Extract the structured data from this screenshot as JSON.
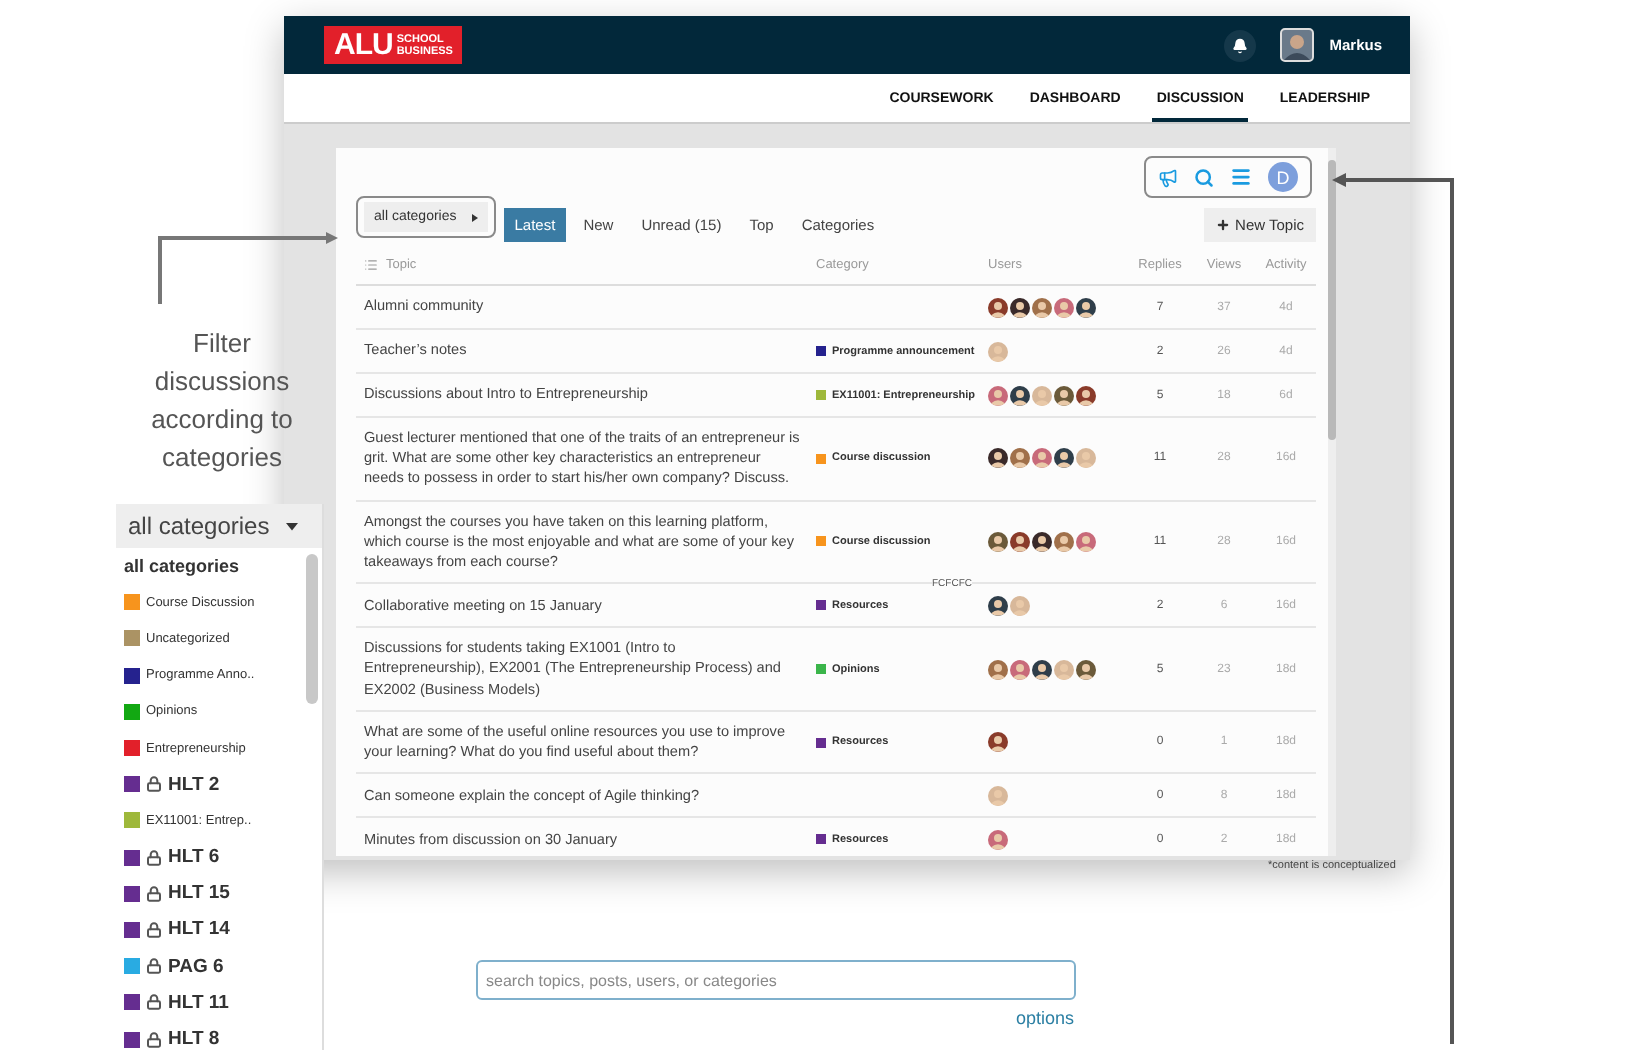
{
  "header": {
    "logo": {
      "mark": "ALU",
      "line_1": "SCHOOL",
      "line_2": "BUSINESS"
    },
    "user_name": "Markus"
  },
  "nav": [
    {
      "label": "COURSEWORK",
      "selected": false
    },
    {
      "label": "DASHBOARD",
      "selected": false
    },
    {
      "label": "DISCUSSION",
      "selected": true
    },
    {
      "label": "LEADERSHIP",
      "selected": false
    }
  ],
  "filter": {
    "label": "all categories"
  },
  "tabs": [
    {
      "label": "Latest",
      "selected": true
    },
    {
      "label": "New",
      "selected": false
    },
    {
      "label": "Unread (15)",
      "selected": false
    },
    {
      "label": "Top",
      "selected": false
    },
    {
      "label": "Categories",
      "selected": false
    }
  ],
  "new_topic_button": {
    "label": "New Topic"
  },
  "user_badge": {
    "letter": "D"
  },
  "table": {
    "columns": [
      "Topic",
      "Category",
      "Users",
      "Replies",
      "Views",
      "Activity"
    ],
    "rows": [
      {
        "topic": "Alumni community",
        "users": [
          {
            "kind": "avatar"
          },
          {
            "kind": "avatar"
          },
          {
            "kind": "avatar"
          },
          {
            "kind": "avatar"
          },
          {
            "kind": "avatar"
          }
        ],
        "replies": "7",
        "views": "37",
        "activity": "4d"
      },
      {
        "topic": "Teacher’s notes",
        "category": {
          "label": "Programme announcement",
          "color": "#25228e"
        },
        "users": [
          {
            "kind": "avatar"
          }
        ],
        "replies": "2",
        "views": "26",
        "activity": "4d"
      },
      {
        "topic": "Discussions about Intro to Entrepreneurship",
        "category": {
          "label": "EX11001: Entrepreneurship",
          "color": "#9eb83b"
        },
        "users": [
          {
            "kind": "avatar"
          },
          {
            "kind": "avatar"
          },
          {
            "kind": "avatar"
          },
          {
            "kind": "avatar"
          },
          {
            "kind": "avatar"
          }
        ],
        "replies": "5",
        "views": "18",
        "activity": "6d"
      },
      {
        "topic": "Guest lecturer mentioned that one of the traits of an entrepreneur is grit. What are some other key characteristics an entrepreneur needs to possess in order to start his/her own company? Discuss.",
        "category": {
          "label": "Course discussion",
          "color": "#f7941d"
        },
        "users": [
          {
            "kind": "avatar"
          },
          {
            "kind": "avatar"
          },
          {
            "kind": "avatar"
          },
          {
            "kind": "avatar"
          },
          {
            "kind": "avatar"
          }
        ],
        "replies": "11",
        "views": "28",
        "activity": "16d"
      },
      {
        "topic": "Amongst the courses you have taken on this learning platform, which course is the most enjoyable and what are some of your key takeaways from each course?",
        "category": {
          "label": "Course discussion",
          "color": "#f7941d"
        },
        "users": [
          {
            "kind": "avatar"
          },
          {
            "kind": "avatar"
          },
          {
            "kind": "avatar"
          },
          {
            "kind": "avatar"
          },
          {
            "kind": "avatar"
          }
        ],
        "replies": "11",
        "views": "28",
        "activity": "16d",
        "note": "FCFCFC"
      },
      {
        "topic": "Collaborative meeting on 15 January",
        "category": {
          "label": "Resources",
          "color": "#652d90"
        },
        "users": [
          {
            "kind": "avatar"
          },
          {
            "kind": "avatar"
          }
        ],
        "replies": "2",
        "views": "6",
        "activity": "16d"
      },
      {
        "topic": "Discussions for students taking EX1001 (Intro to Entrepreneurship), EX2001 (The Entrepreneurship Process) and EX2002 (Business Models)",
        "category": {
          "label": "Opinions",
          "color": "#3ab54a"
        },
        "users": [
          {
            "kind": "avatar"
          },
          {
            "kind": "avatar"
          },
          {
            "kind": "avatar"
          },
          {
            "kind": "avatar"
          },
          {
            "kind": "avatar"
          }
        ],
        "replies": "5",
        "views": "23",
        "activity": "18d"
      },
      {
        "topic": "What are some of the useful online resources you use to improve your learning? What do you find useful about them?",
        "category": {
          "label": "Resources",
          "color": "#652d90"
        },
        "users": [
          {
            "kind": "avatar"
          }
        ],
        "replies": "0",
        "views": "1",
        "activity": "18d"
      },
      {
        "topic": "Can someone explain the concept of Agile thinking?",
        "users": [
          {
            "kind": "avatar"
          }
        ],
        "replies": "0",
        "views": "8",
        "activity": "18d"
      },
      {
        "topic": "Minutes from discussion on 30 January",
        "category": {
          "label": "Resources",
          "color": "#652d90"
        },
        "users": [
          {
            "kind": "avatar"
          }
        ],
        "replies": "0",
        "views": "2",
        "activity": "18d"
      }
    ]
  },
  "footnote": "*content is conceptualized",
  "annotation": "Filter discussions according to categories",
  "dropdown": {
    "label": "all categories",
    "items": [
      {
        "kind": "heading",
        "label": "all categories"
      },
      {
        "kind": "category",
        "label": "Course Discussion",
        "color": "#f7941d",
        "locked": false
      },
      {
        "kind": "category",
        "label": "Uncategorized",
        "color": "#ab9364",
        "locked": false
      },
      {
        "kind": "category",
        "label": "Programme Anno..",
        "color": "#25228e",
        "locked": false
      },
      {
        "kind": "category",
        "label": "Opinions",
        "color": "#12a812",
        "locked": false
      },
      {
        "kind": "category",
        "label": "Entrepreneurship",
        "color": "#e2202a",
        "locked": false
      },
      {
        "kind": "category",
        "label": "HLT 2",
        "color": "#652d90",
        "locked": true
      },
      {
        "kind": "category",
        "label": "EX11001: Entrep..",
        "color": "#9eb83b",
        "locked": false
      },
      {
        "kind": "category",
        "label": "HLT 6",
        "color": "#652d90",
        "locked": true
      },
      {
        "kind": "category",
        "label": "HLT 15",
        "color": "#652d90",
        "locked": true
      },
      {
        "kind": "category",
        "label": "HLT 14",
        "color": "#652d90",
        "locked": true
      },
      {
        "kind": "category",
        "label": "PAG 6",
        "color": "#29abe2",
        "locked": true
      },
      {
        "kind": "category",
        "label": "HLT 11",
        "color": "#652d90",
        "locked": true
      },
      {
        "kind": "category",
        "label": "HLT 8",
        "color": "#652d90",
        "locked": true
      }
    ]
  },
  "search": {
    "placeholder": "search topics, posts, users, or categories"
  },
  "options_link": "options"
}
